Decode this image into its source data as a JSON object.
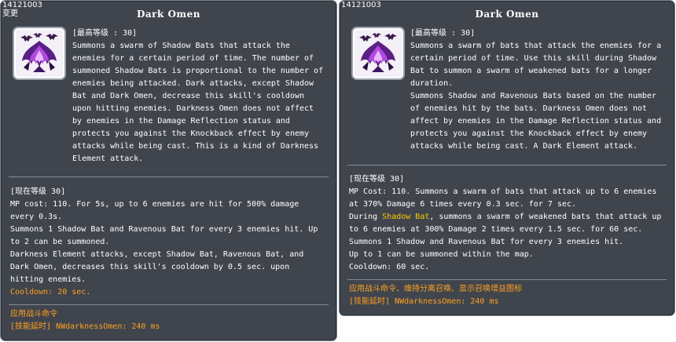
{
  "colors": {
    "panel_bg": "#383d46",
    "text": "#ffffff",
    "highlight": "#ffcc00",
    "note": "#ffa020"
  },
  "icon": "dark-omen-skill-icon",
  "left": {
    "id_tag": "14121003",
    "change_tag": "变更",
    "title": "Dark Omen",
    "max_level": "[最高等级 : 30]",
    "description": "Summons a swarm of Shadow Bats that attack the\nenemies for a certain period of time. The number of\nsummoned Shadow Bats is proportional to the number of\nenemies being attacked. Dark attacks, except Shadow\nBat and Dark Omen, decrease this skill's cooldown\nupon hitting enemies. Darkness Omen does not affect\nby enemies in the Damage Reflection status and\nprotects you against the Knockback effect by enemy\nattacks while being cast. This is a kind of Darkness\nElement attack.",
    "current_level": "[现在等级 30]",
    "level_text": "MP cost: 110. For 5s, up to 6 enemies are hit for 500% damage\nevery 0.3s.\nSummons 1 Shadow Bat and Ravenous Bat for every 3 enemies hit. Up\nto 2 can be summoned.\nDarkness Element attacks, except Shadow Bat, Ravenous Bat, and\nDark Omen, decreases this skill's cooldown by 0.5 sec. upon\nhitting enemies.",
    "cooldown": "Cooldown: 20 sec.",
    "footer_line1": "应用战斗命令",
    "footer_line2": "[技能延时] NWdarknessOmen: 240 ms"
  },
  "right": {
    "id_tag": "14121003",
    "title": "Dark Omen",
    "max_level": "[最高等级 : 30]",
    "description": "Summons a swarm of bats that attack the enemies for a\ncertain period of time. Use this skill during Shadow\nBat to summon a swarm of weakened bats for a longer\nduration.\nSummons Shadow and Ravenous Bats based on the number\nof enemies hit by the bats. Darkness Omen does not\naffect by enemies in the Damage Reflection status and\nprotects you against the Knockback effect by enemy\nattacks while being cast. A Dark Element attack.",
    "current_level": "[现在等级 30]",
    "level_line1": "MP Cost: 110. Summons a swarm of bats that attack up to 6 enemies\nat 370% Damage 6 times every 0.3 sec. for 7 sec.",
    "level_line2_pre": "During ",
    "level_line2_hl": "Shadow Bat",
    "level_line2_post": ", summons a swarm of weakened bats that attack up\nto 6 enemies at 300% Damage 2 times every 1.5 sec. for 60 sec.\nSummons 1 Shadow and Ravenous Bat for every 3 enemies hit.\nUp to 1 can be summoned within the map.\nCooldown: 60 sec.",
    "footer_line1": "应用战斗命令、维持分离召唤、显示召唤增益图标",
    "footer_line2": "[技能延时] NWdarknessOmen: 240 ms"
  }
}
